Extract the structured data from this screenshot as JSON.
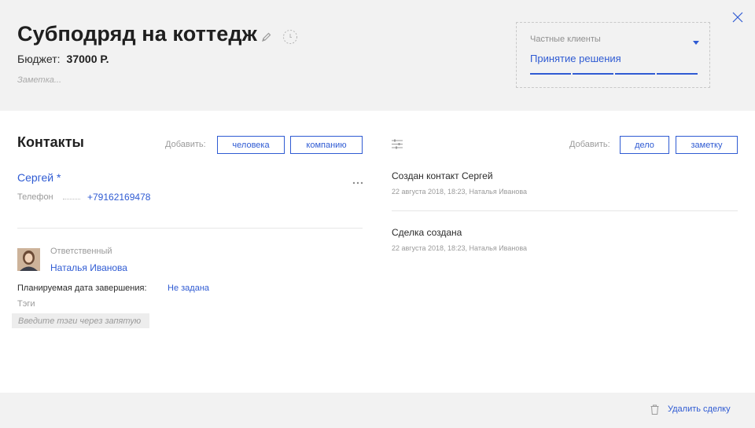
{
  "deal": {
    "title": "Субподряд на коттедж",
    "budget_label": "Бюджет:",
    "budget_value": "37000 Р.",
    "note_placeholder": "Заметка..."
  },
  "pipeline": {
    "name": "Частные клиенты",
    "stage": "Принятие решения",
    "stage_progress": 1.0
  },
  "contacts": {
    "title": "Контакты",
    "add_label": "Добавить:",
    "add_person_label": "человека",
    "add_company_label": "компанию",
    "contact": {
      "name": "Сергей *",
      "phone_label": "Телефон",
      "phone_value": "+79162169478"
    },
    "responsible_label": "Ответственный",
    "responsible_name": "Наталья Иванова",
    "due_label": "Планируемая дата завершения:",
    "due_value": "Не задана",
    "tags_label": "Тэги",
    "tags_placeholder": "Введите тэги через запятую"
  },
  "feed": {
    "add_label": "Добавить:",
    "add_task_label": "дело",
    "add_note_label": "заметку",
    "events": [
      {
        "title": "Создан контакт Сергей",
        "meta": "22 августа 2018, 18:23, Наталья Иванова"
      },
      {
        "title": "Сделка создана",
        "meta": "22 августа 2018, 18:23, Наталья Иванова"
      }
    ]
  },
  "footer": {
    "delete_label": "Удалить сделку"
  },
  "colors": {
    "accent": "#2f5bd3",
    "panel_bg": "#f2f2f2",
    "muted_text": "#9a9a9a"
  },
  "icons": [
    "pencil-icon",
    "timer-icon",
    "caret-down-icon",
    "close-icon",
    "more-icon",
    "filter-icon",
    "trash-icon"
  ]
}
